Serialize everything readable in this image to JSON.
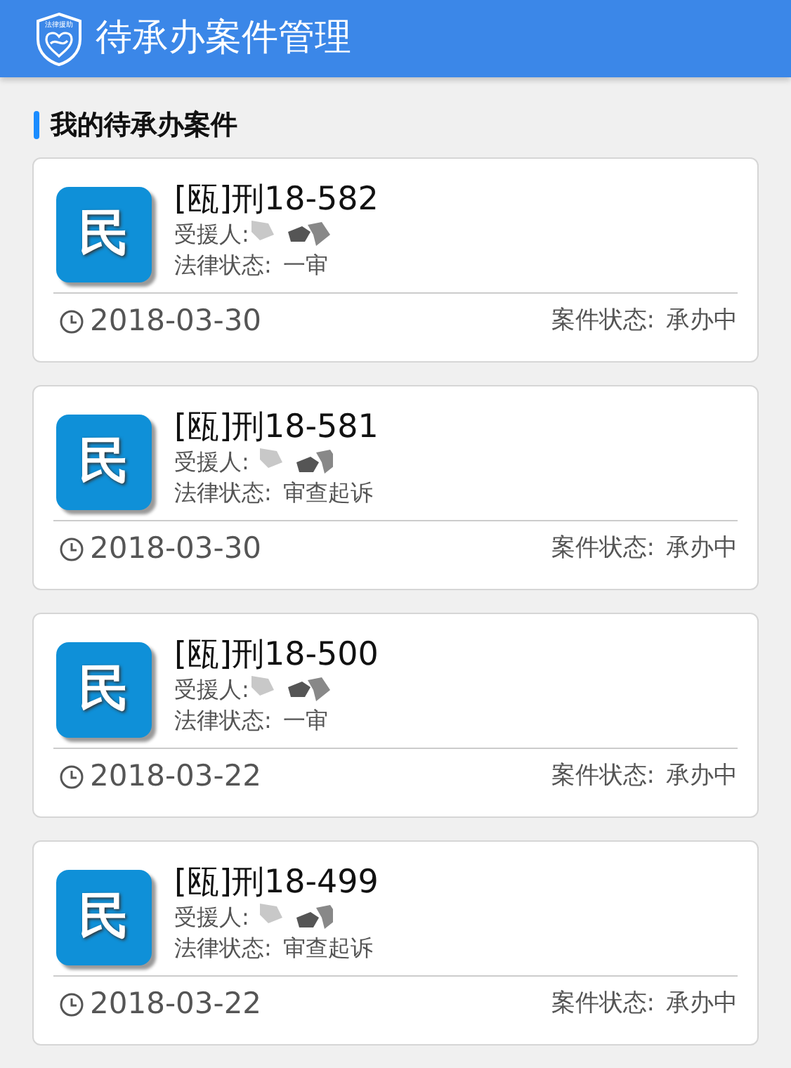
{
  "header": {
    "logo_text": "法律援助",
    "title": "待承办案件管理"
  },
  "section_title": "我的待承办案件",
  "cases": [
    {
      "badge": "民",
      "case_no": "[瓯]刑18-582",
      "recipient_label": "受援人:",
      "recipient_redacted": true,
      "legal_status_label": "法律状态:",
      "legal_status": "一审",
      "date": "2018-03-30",
      "case_status_label": "案件状态:",
      "case_status": "承办中"
    },
    {
      "badge": "民",
      "case_no": "[瓯]刑18-581",
      "recipient_label": "受援人:",
      "recipient_redacted": true,
      "legal_status_label": "法律状态:",
      "legal_status": "审查起诉",
      "date": "2018-03-30",
      "case_status_label": "案件状态:",
      "case_status": "承办中"
    },
    {
      "badge": "民",
      "case_no": "[瓯]刑18-500",
      "recipient_label": "受援人:",
      "recipient_redacted": true,
      "legal_status_label": "法律状态:",
      "legal_status": "一审",
      "date": "2018-03-22",
      "case_status_label": "案件状态:",
      "case_status": "承办中"
    },
    {
      "badge": "民",
      "case_no": "[瓯]刑18-499",
      "recipient_label": "受援人:",
      "recipient_redacted": true,
      "legal_status_label": "法律状态:",
      "legal_status": "审查起诉",
      "date": "2018-03-22",
      "case_status_label": "案件状态:",
      "case_status": "承办中"
    }
  ]
}
